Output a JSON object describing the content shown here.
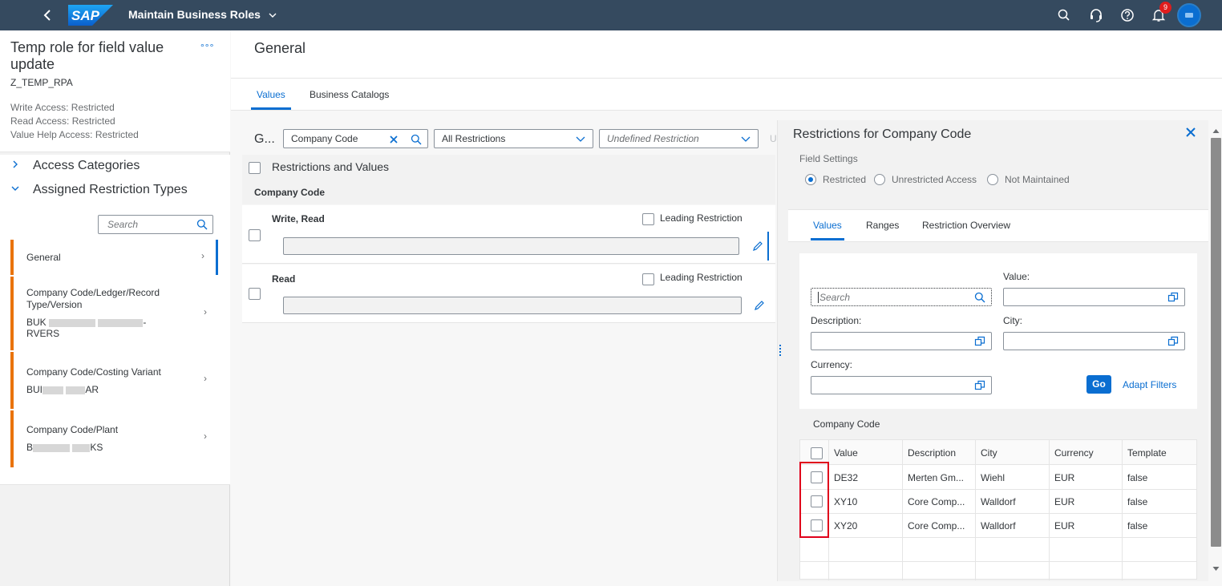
{
  "shell": {
    "app_title": "Maintain Business Roles",
    "logo_text": "SAP",
    "notification_count": "9"
  },
  "role": {
    "title": "Temp role for field value update",
    "id": "Z_TEMP_RPA",
    "write_access": "Write Access: Restricted",
    "read_access": "Read Access: Restricted",
    "value_help_access": "Value Help Access: Restricted",
    "more": "°°°"
  },
  "tree": {
    "access_categories": "Access Categories",
    "assigned_restriction_types": "Assigned Restriction Types",
    "search_placeholder": "Search"
  },
  "restriction_types": [
    {
      "title": "General"
    },
    {
      "title": "Company Code/Ledger/Record Type/Version",
      "sub_prefix": "BUK",
      "sub_end": "-",
      "sub_line2": "RVERS"
    },
    {
      "title": "Company Code/Costing Variant",
      "sub_prefix": "BUI",
      "sub_end": "AR"
    },
    {
      "title": "Company Code/Plant",
      "sub_prefix": "B",
      "sub_end": "KS"
    }
  ],
  "main": {
    "title": "General",
    "tabs": [
      "Values",
      "Business Catalogs"
    ],
    "group_label": "G...",
    "field_filter": "Company Code",
    "restriction_filter": "All Restrictions",
    "undefined_filter": "Undefined Restriction",
    "cut_label": "U",
    "restrictions_and_values": "Restrictions and Values",
    "company_code_header": "Company Code",
    "rows": [
      {
        "label": "Write, Read",
        "leading": "Leading Restriction"
      },
      {
        "label": "Read",
        "leading": "Leading Restriction"
      }
    ]
  },
  "panel": {
    "title": "Restrictions for Company Code",
    "field_settings": "Field Settings",
    "radio_restricted": "Restricted",
    "radio_unrestricted": "Unrestricted Access",
    "radio_not_maintained": "Not Maintained",
    "tabs": [
      "Values",
      "Ranges",
      "Restriction Overview"
    ],
    "search_placeholder": "Search",
    "value_label": "Value:",
    "description_label": "Description:",
    "city_label": "City:",
    "currency_label": "Currency:",
    "go": "Go",
    "adapt_filters": "Adapt Filters",
    "table_title": "Company Code",
    "columns": [
      "Value",
      "Description",
      "City",
      "Currency",
      "Template"
    ],
    "rows": [
      [
        "DE32",
        "Merten Gm...",
        "Wiehl",
        "EUR",
        "false"
      ],
      [
        "XY10",
        "Core Comp...",
        "Walldorf",
        "EUR",
        "false"
      ],
      [
        "XY20",
        "Core Comp...",
        "Walldorf",
        "EUR",
        "false"
      ]
    ]
  },
  "colors": {
    "shell": "#354a5f",
    "accent": "#0a6ed1",
    "orange": "#e9730c",
    "highlight": "#e0001b"
  }
}
